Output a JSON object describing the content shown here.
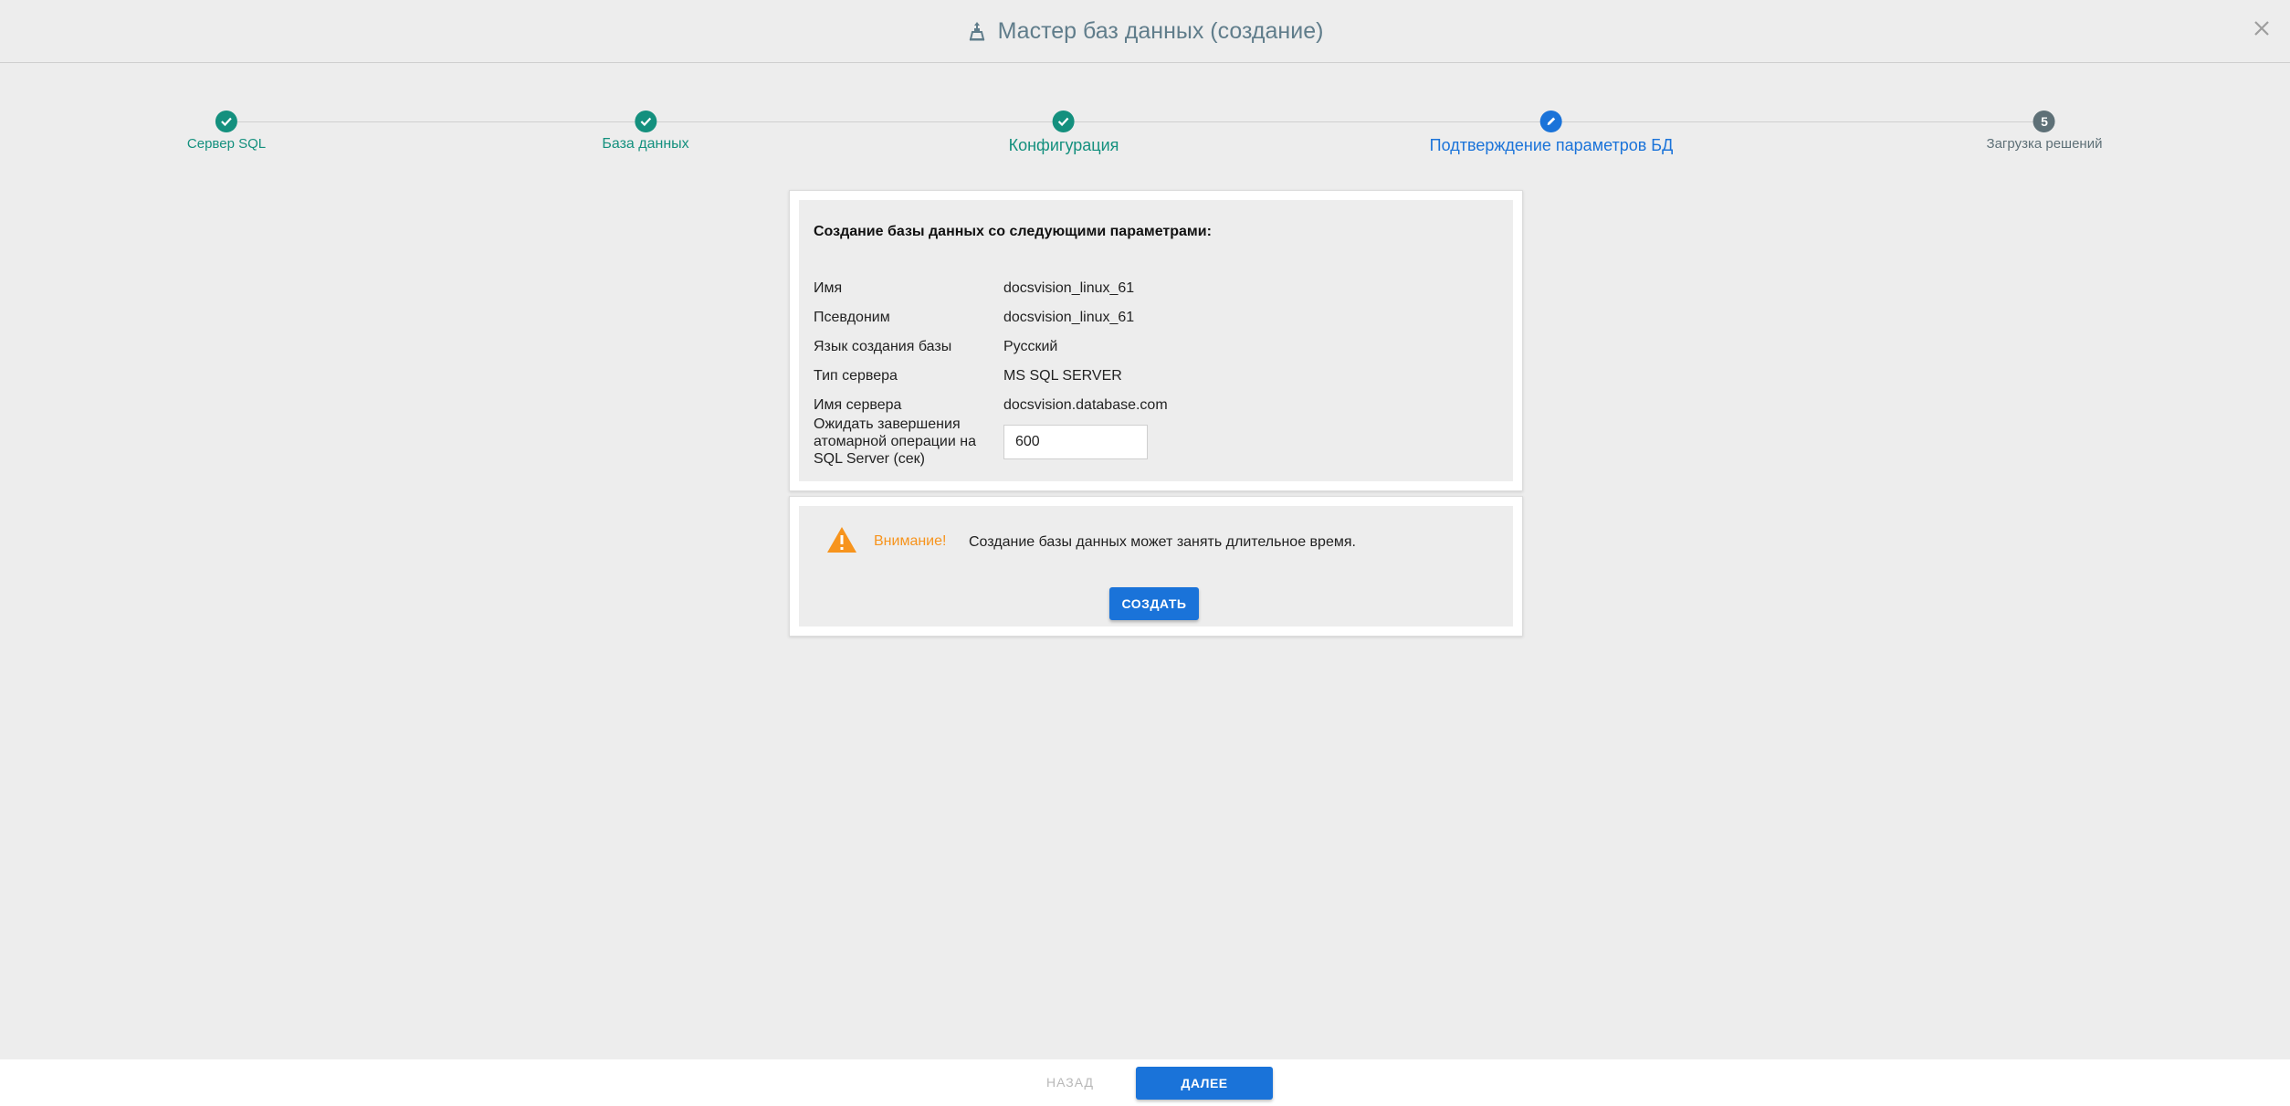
{
  "header": {
    "title": "Мастер баз данных (создание)",
    "icon": "wizard-icon",
    "close_icon": "close-icon"
  },
  "steps": [
    {
      "label": "Сервер SQL",
      "state": "done"
    },
    {
      "label": "База данных",
      "state": "done"
    },
    {
      "label": "Конфигурация",
      "state": "done"
    },
    {
      "label": "Подтверждение параметров БД",
      "state": "active"
    },
    {
      "label": "Загрузка решений",
      "number": "5",
      "state": "todo"
    }
  ],
  "params": {
    "heading": "Создание базы данных со следующими параметрами:",
    "rows": [
      {
        "key": "Имя",
        "value": "docsvision_linux_61"
      },
      {
        "key": "Псевдоним",
        "value": "docsvision_linux_61"
      },
      {
        "key": "Язык создания базы",
        "value": "Русский"
      },
      {
        "key": "Тип сервера",
        "value": "MS SQL SERVER"
      },
      {
        "key": "Имя сервера",
        "value": "docsvision.database.com"
      }
    ],
    "timeout": {
      "label": "Ожидать завершения атомарной операции на SQL Server (сек)",
      "value": "600"
    }
  },
  "warning": {
    "icon": "warning-icon",
    "label": "Внимание!",
    "text": "Создание базы данных может занять длительное время.",
    "create_label": "СОЗДАТЬ"
  },
  "footer": {
    "back_label": "НАЗАД",
    "next_label": "ДАЛЕЕ"
  },
  "colors": {
    "done": "#14907e",
    "active": "#1a73d9",
    "todo": "#5e7077",
    "warning": "#f7941d"
  }
}
